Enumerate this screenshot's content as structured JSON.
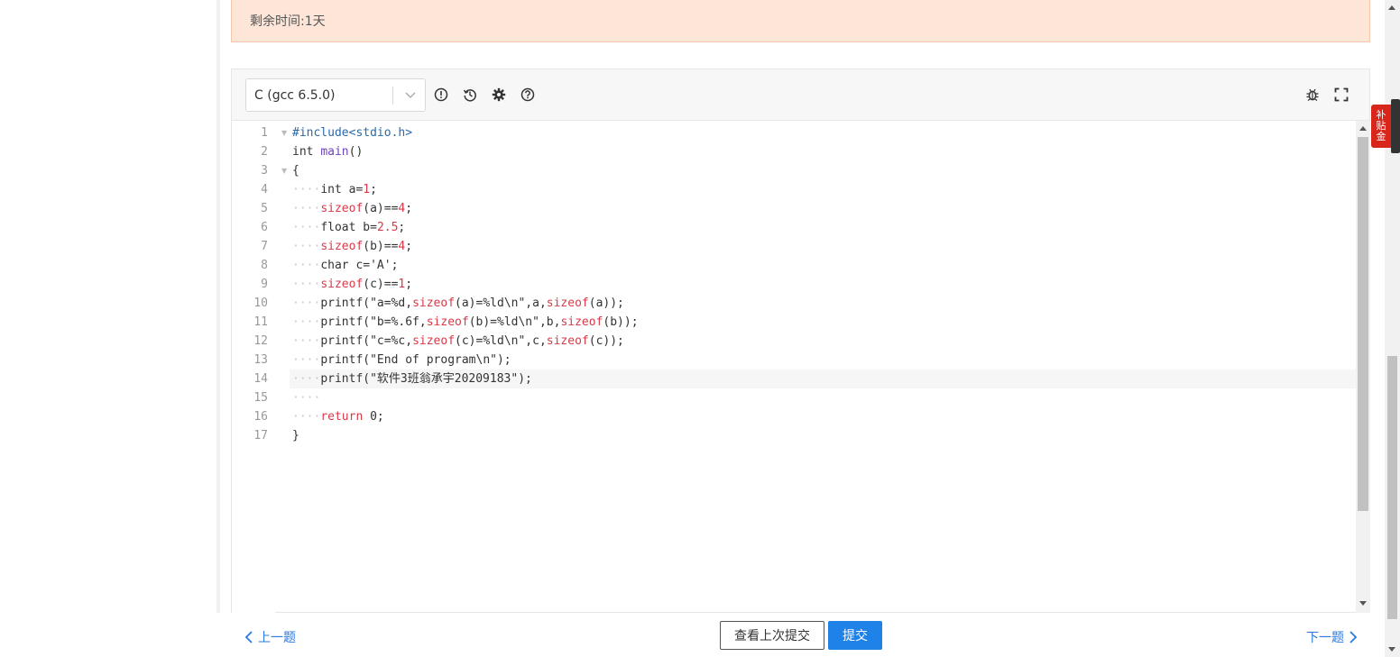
{
  "timer": {
    "text": "剩余时间:1天"
  },
  "editor": {
    "language": "C (gcc 6.5.0)",
    "toolbar_icons": [
      "info-icon",
      "history-icon",
      "gear-icon",
      "help-icon",
      "bug-icon",
      "fullscreen-icon"
    ],
    "lines": [
      "#include<stdio.h>",
      "int main()",
      "{",
      "    int a=1;",
      "    sizeof(a)==4;",
      "    float b=2.5;",
      "    sizeof(b)==4;",
      "    char c='A';",
      "    sizeof(c)==1;",
      "    printf(\"a=%d,sizeof(a)=%ld\\n\",a,sizeof(a));",
      "    printf(\"b=%.6f,sizeof(b)=%ld\\n\",b,sizeof(b));",
      "    printf(\"c=%c,sizeof(c)=%ld\\n\",c,sizeof(c));",
      "    printf(\"End of program\\n\");",
      "    printf(\"软件3班翁承宇20209183\");",
      "    ",
      "    return 0;",
      "}"
    ],
    "line_numbers": [
      "1",
      "2",
      "3",
      "4",
      "5",
      "6",
      "7",
      "8",
      "9",
      "10",
      "11",
      "12",
      "13",
      "14",
      "15",
      "16",
      "17"
    ]
  },
  "footer": {
    "prev_label": "上一题",
    "view_last_label": "查看上次提交",
    "submit_label": "提交",
    "next_label": "下一题"
  },
  "side_tab": {
    "c1": "补",
    "c2": "贴",
    "c3": "金"
  },
  "colors": {
    "accent": "#1e82e9",
    "timer_bg": "#fde6d8",
    "side_tab": "#d8261b"
  }
}
